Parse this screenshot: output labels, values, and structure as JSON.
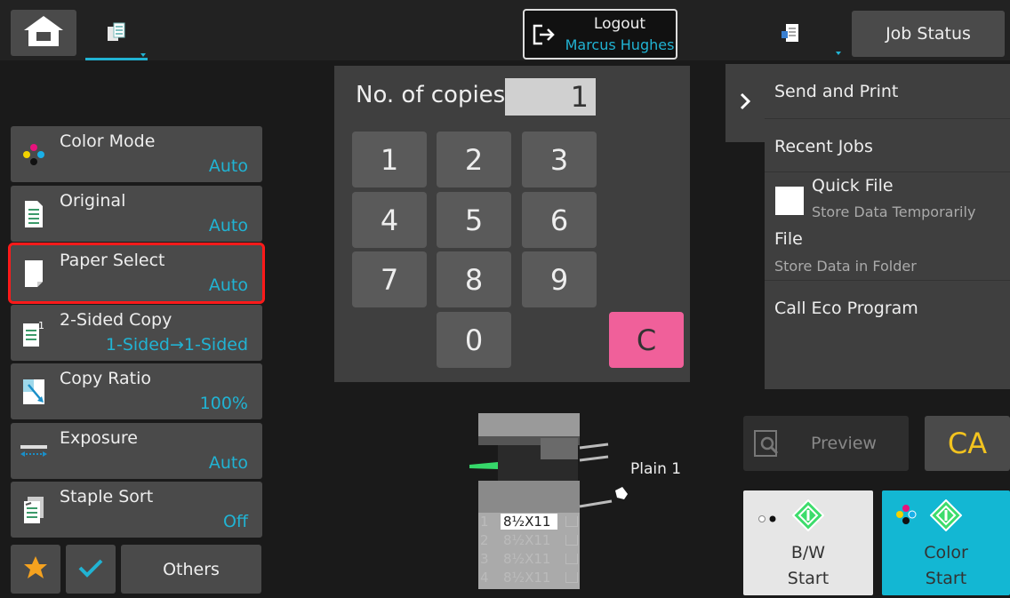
{
  "header": {
    "logout_label": "Logout",
    "user_name": "Marcus Hughes",
    "job_status_label": "Job Status"
  },
  "functions": [
    {
      "name": "Color Mode",
      "value": "Auto",
      "icon": "color-mode-icon"
    },
    {
      "name": "Original",
      "value": "Auto",
      "icon": "original-icon"
    },
    {
      "name": "Paper Select",
      "value": "Auto",
      "icon": "paper-select-icon",
      "selected": true
    },
    {
      "name": "2-Sided Copy",
      "value": "1-Sided→1-Sided",
      "icon": "two-sided-icon"
    },
    {
      "name": "Copy Ratio",
      "value": "100%",
      "icon": "copy-ratio-icon"
    },
    {
      "name": "Exposure",
      "value": "Auto",
      "icon": "exposure-icon"
    },
    {
      "name": "Staple Sort",
      "value": "Off",
      "icon": "staple-sort-icon"
    }
  ],
  "bottom_left": {
    "others_label": "Others"
  },
  "copies": {
    "label": "No. of copies",
    "value": "1"
  },
  "keypad": {
    "keys": [
      "1",
      "2",
      "3",
      "4",
      "5",
      "6",
      "7",
      "8",
      "9",
      "0"
    ],
    "clear_label": "C"
  },
  "right_panel": {
    "send_print": "Send and Print",
    "recent_jobs": "Recent Jobs",
    "quick_file": "Quick File",
    "quick_file_sub": "Store Data Temporarily",
    "file": "File",
    "file_sub": "Store Data in Folder",
    "eco": "Call Eco Program"
  },
  "machine": {
    "paper_label": "Plain 1",
    "trays": [
      {
        "num": "1",
        "size": "8½X11"
      },
      {
        "num": "2",
        "size": "8½X11"
      },
      {
        "num": "3",
        "size": "8½X11"
      },
      {
        "num": "4",
        "size": "8½X11"
      }
    ]
  },
  "actions": {
    "preview_label": "Preview",
    "ca_label": "CA",
    "bw_line1": "B/W",
    "bw_line2": "Start",
    "color_line1": "Color",
    "color_line2": "Start"
  },
  "colors": {
    "accent": "#21b3d3",
    "clear_key": "#f0609a",
    "ca": "#f2c31f",
    "selection_outline": "#ff1a1a",
    "start_green": "#3ddc6c"
  }
}
